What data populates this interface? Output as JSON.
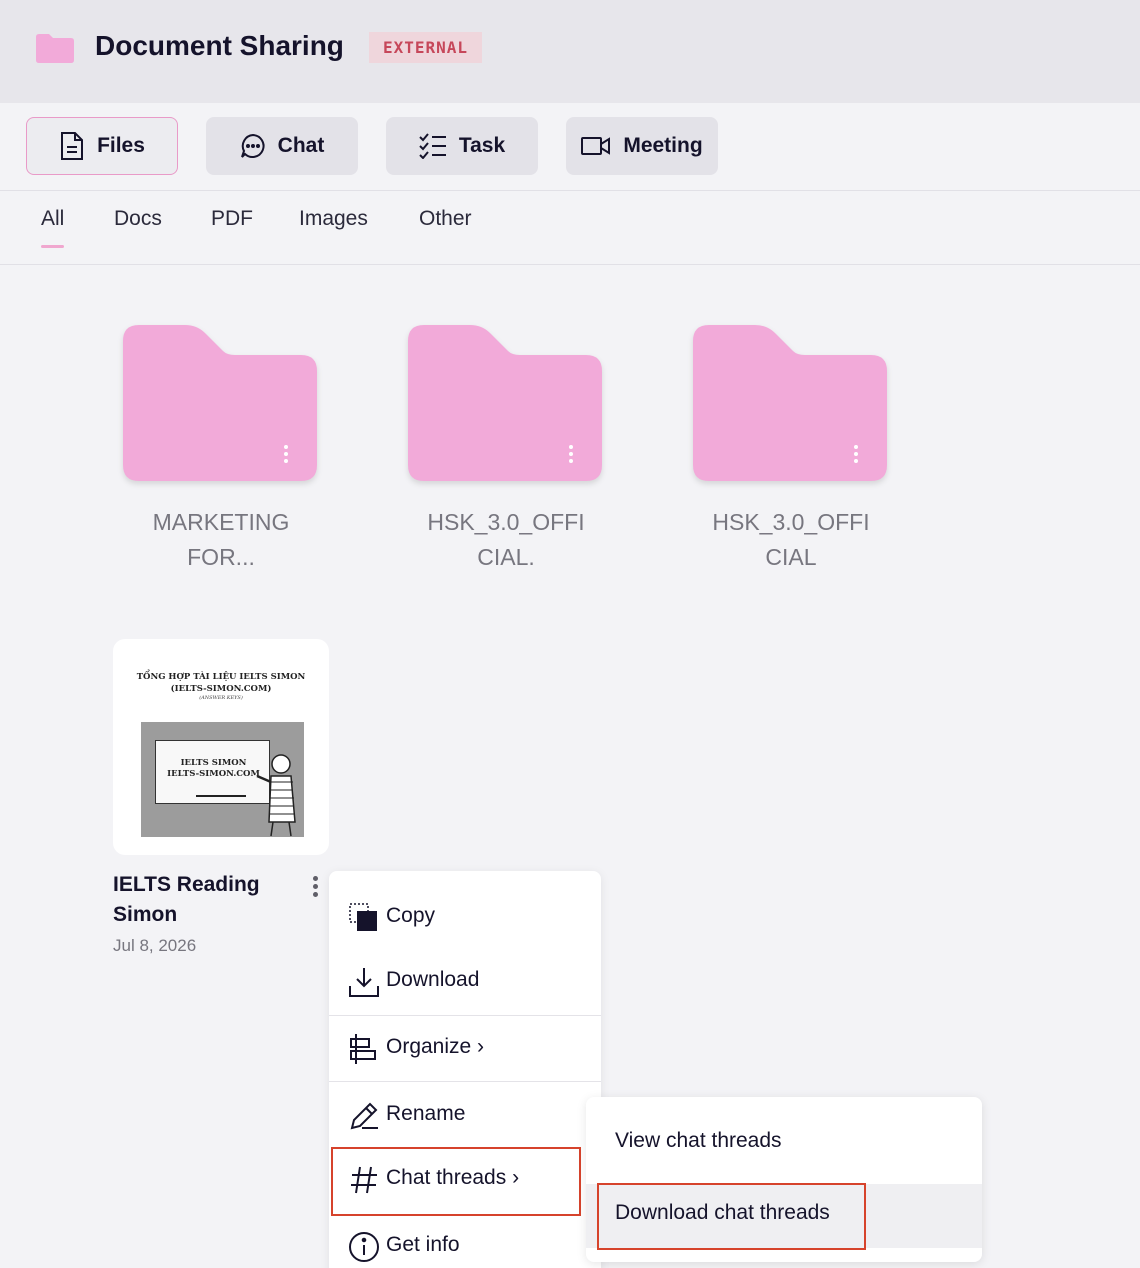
{
  "header": {
    "title": "Document Sharing",
    "badge": "EXTERNAL"
  },
  "toolbar": {
    "files": "Files",
    "chat": "Chat",
    "task": "Task",
    "meeting": "Meeting"
  },
  "subtabs": [
    "All",
    "Docs",
    "PDF",
    "Images",
    "Other"
  ],
  "folders": [
    {
      "name_line1": "MARKETING",
      "name_line2": "FOR..."
    },
    {
      "name_line1": "HSK_3.0_OFFI",
      "name_line2": "CIAL."
    },
    {
      "name_line1": "HSK_3.0_OFFI",
      "name_line2": "CIAL"
    }
  ],
  "file": {
    "title": "IELTS Reading Simon",
    "date": "Jul 8, 2026",
    "thumb_heading_1": "TỔNG HỢP TÀI LIỆU IELTS SIMON",
    "thumb_heading_2": "(IELTS-SIMON.COM)",
    "thumb_sub": "(ANSWER KEYS)",
    "thumb_board_1": "IELTS SIMON",
    "thumb_board_2": "IELTS-SIMON.COM"
  },
  "context_menu": {
    "copy": "Copy",
    "download": "Download",
    "organize": "Organize ›",
    "rename": "Rename",
    "chat_threads": "Chat threads ›",
    "get_info": "Get info"
  },
  "submenu": {
    "view": "View chat threads",
    "download": "Download chat threads"
  },
  "colors": {
    "accent_pink": "#f2aad9",
    "badge_text": "#c6475a",
    "highlight_red": "#d6432c"
  }
}
